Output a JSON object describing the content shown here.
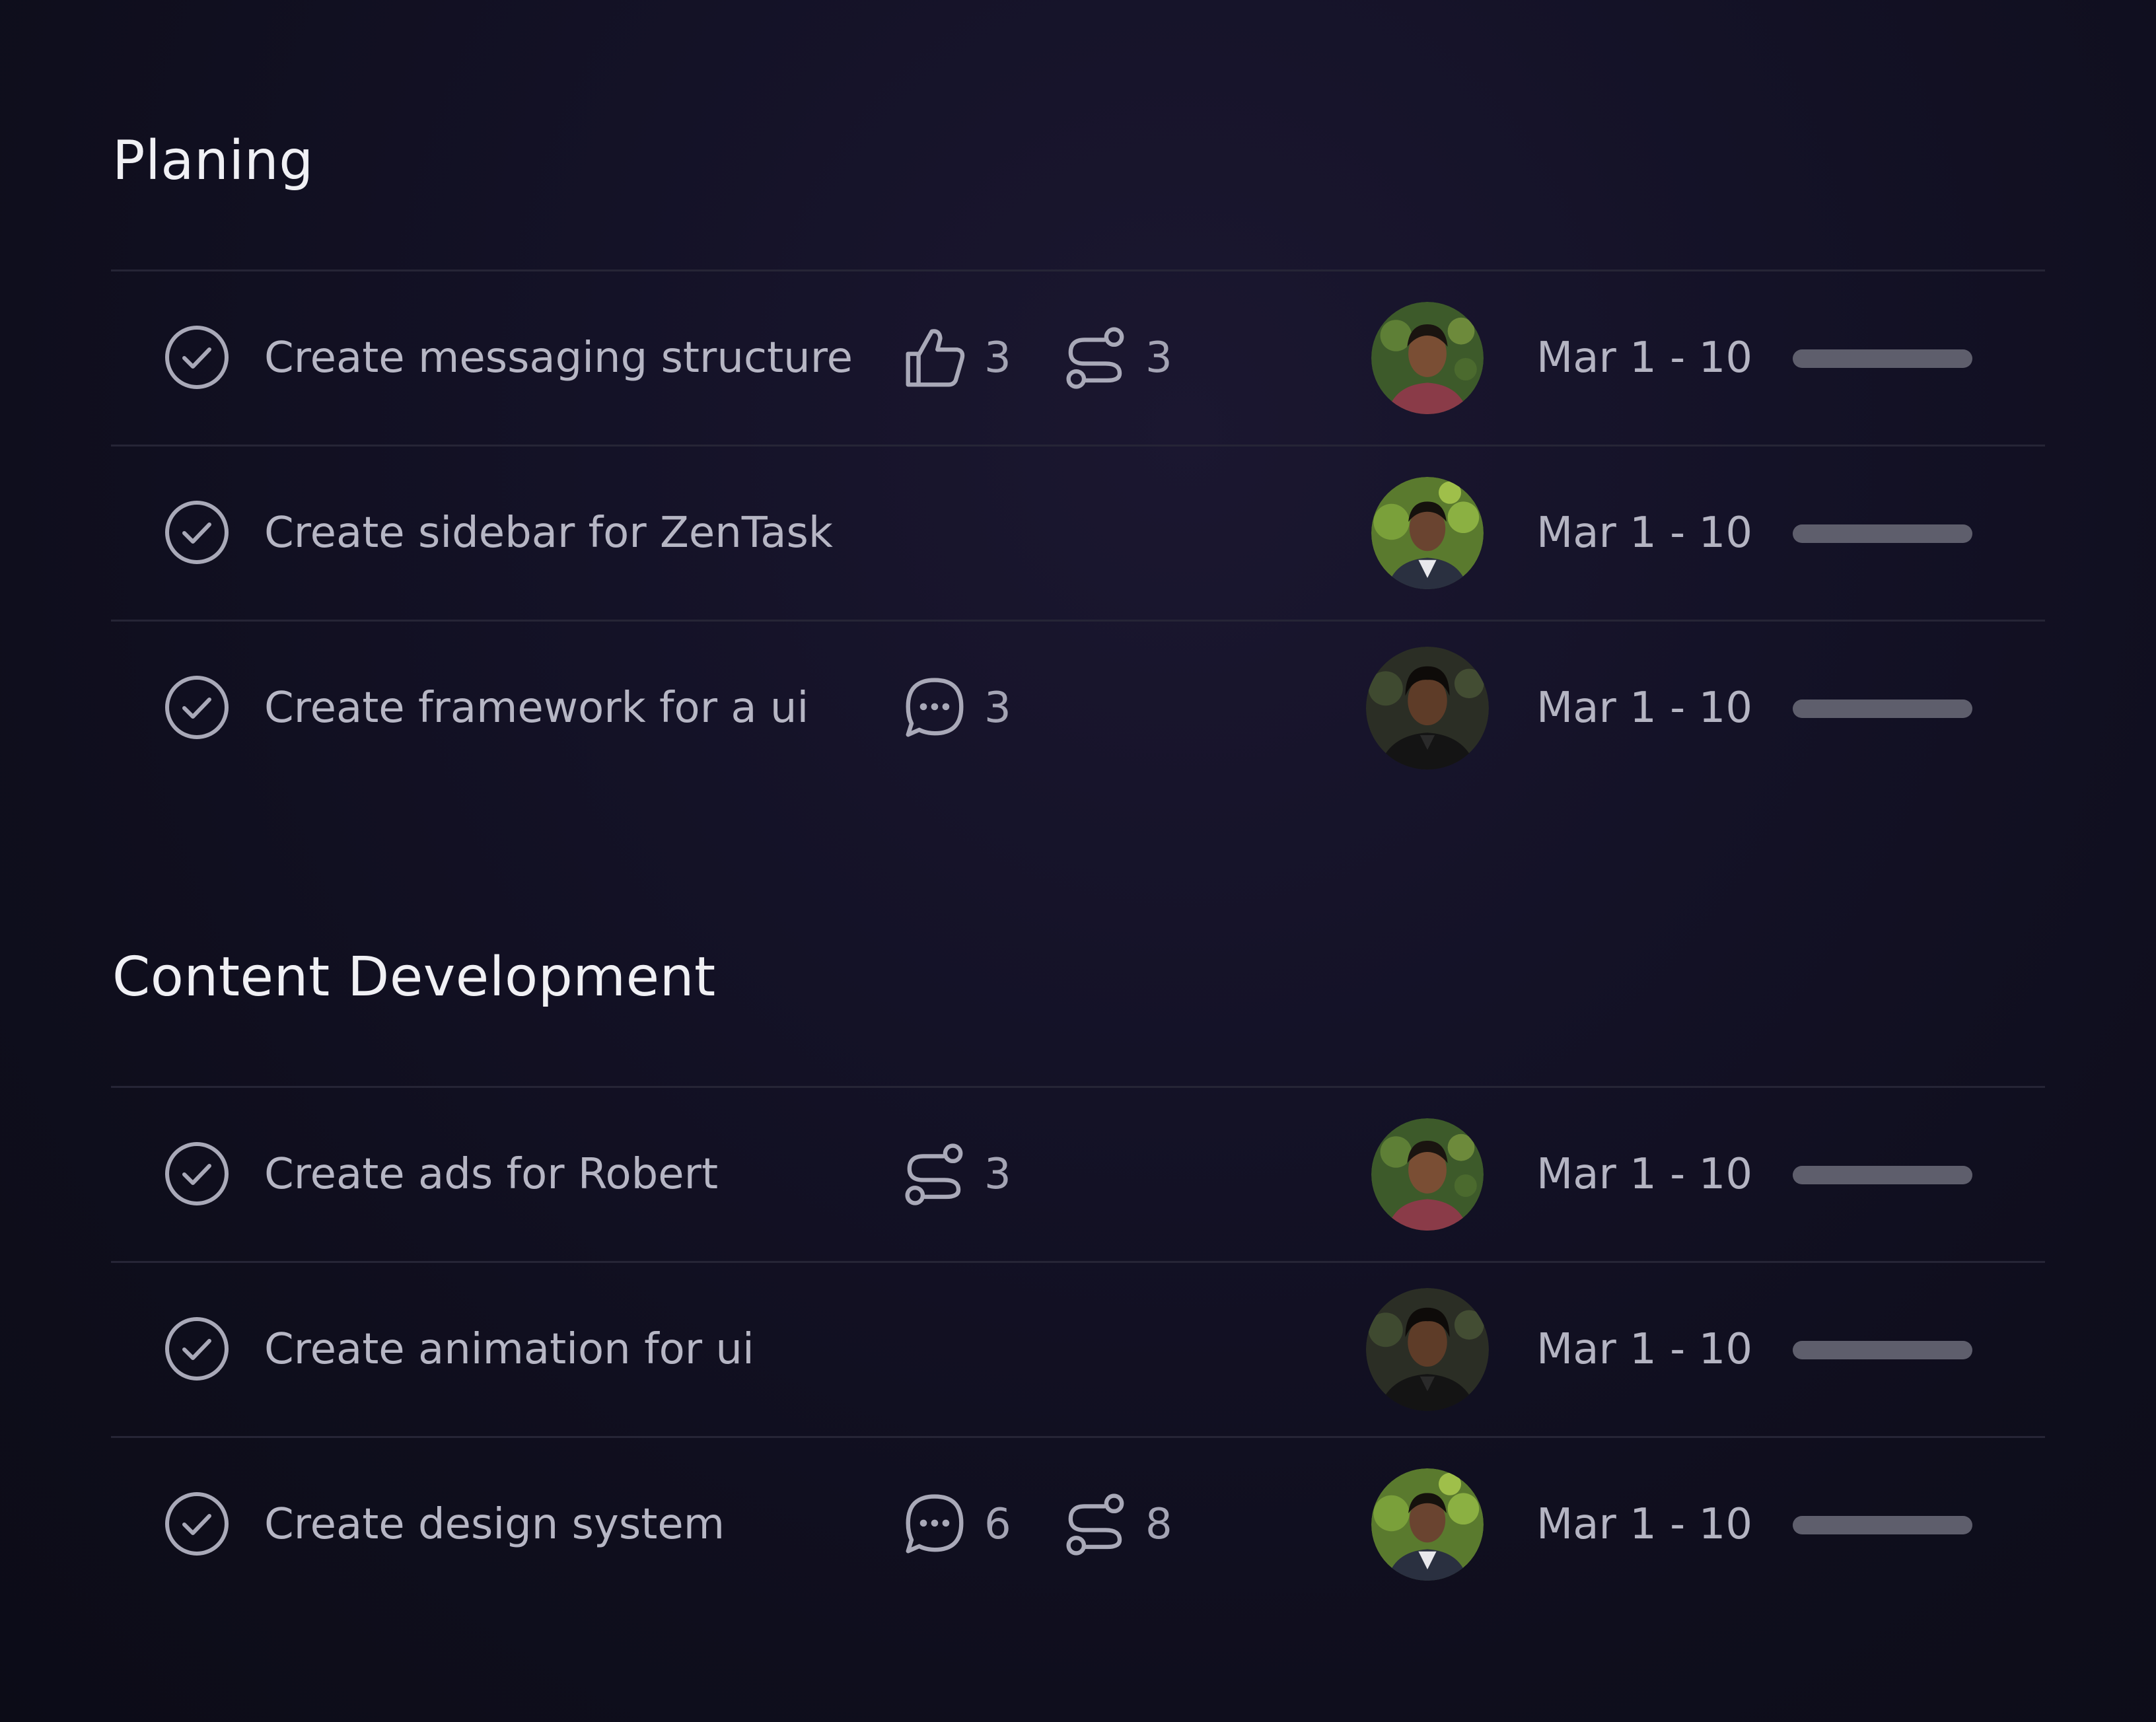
{
  "colors": {
    "background": "#12111f",
    "divider": "#262536",
    "title": "#f0f0f4",
    "text": "#b6b6c4",
    "icon": "#a9a9b8",
    "progress_track": "#5e5e6c"
  },
  "sections": [
    {
      "title": "Planing",
      "tasks": [
        {
          "name": "Create messaging structure",
          "meta": [
            {
              "icon": "thumbs-up-icon",
              "count": "3"
            },
            {
              "icon": "subtask-icon",
              "count": "3"
            }
          ],
          "date": "Mar 1 - 10",
          "avatar": "avatar-red-shirt"
        },
        {
          "name": "Create sidebar for ZenTask",
          "meta": [],
          "date": "Mar 1 - 10",
          "avatar": "avatar-white-shirt"
        },
        {
          "name": "Create framework for a ui",
          "meta": [
            {
              "icon": "comment-icon",
              "count": "3"
            }
          ],
          "date": "Mar 1 - 10",
          "avatar": "avatar-black-suit"
        }
      ]
    },
    {
      "title": "Content Development",
      "tasks": [
        {
          "name": "Create ads for Robert",
          "meta": [
            {
              "icon": "subtask-icon",
              "count": "3"
            }
          ],
          "date": "Mar 1 - 10",
          "avatar": "avatar-red-shirt"
        },
        {
          "name": "Create animation for ui",
          "meta": [],
          "date": "Mar 1 - 10",
          "avatar": "avatar-black-suit"
        },
        {
          "name": "Create design system",
          "meta": [
            {
              "icon": "comment-icon",
              "count": "6"
            },
            {
              "icon": "subtask-icon",
              "count": "8"
            }
          ],
          "date": "Mar 1 - 10",
          "avatar": "avatar-white-shirt"
        }
      ]
    }
  ]
}
